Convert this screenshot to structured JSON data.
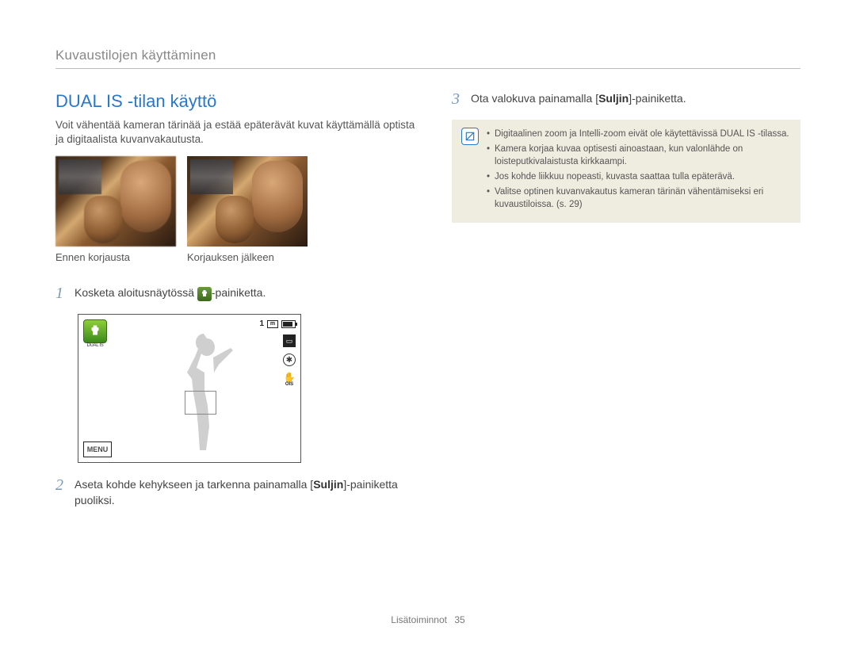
{
  "breadcrumb": "Kuvaustilojen käyttäminen",
  "title": "DUAL IS -tilan käyttö",
  "intro": "Voit vähentää kameran tärinää ja estää epäterävät kuvat käyttämällä optista ja digitaalista kuvanvakautusta.",
  "compare": {
    "before_caption": "Ennen korjausta",
    "after_caption": "Korjauksen jälkeen"
  },
  "steps": {
    "s1": {
      "num": "1",
      "pre": "Kosketa aloitusnäytössä ",
      "post": "-painiketta."
    },
    "s2": {
      "num": "2",
      "pre": "Aseta kohde kehykseen ja tarkenna painamalla [",
      "bold": "Suljin",
      "post": "]-painiketta puoliksi."
    },
    "s3": {
      "num": "3",
      "pre": "Ota valokuva painamalla [",
      "bold": "Suljin",
      "post": "]-painiketta."
    }
  },
  "camera": {
    "dualis_label": "DUAL IS",
    "counter": "1",
    "mem_badge": "m",
    "res_badge": "☐",
    "flash_badge": "✱",
    "ois_label": "OIS",
    "menu_label": "MENU"
  },
  "notes": [
    "Digitaalinen zoom ja Intelli-zoom eivät ole käytettävissä DUAL IS -tilassa.",
    "Kamera korjaa kuvaa optisesti ainoastaan, kun valonlähde on loisteputkivalaistusta kirkkaampi.",
    "Jos kohde liikkuu nopeasti, kuvasta saattaa tulla epäterävä.",
    "Valitse optinen kuvanvakautus kameran tärinän vähentämiseksi eri kuvaustiloissa. (s. 29)"
  ],
  "footer": {
    "section": "Lisätoiminnot",
    "page": "35"
  }
}
